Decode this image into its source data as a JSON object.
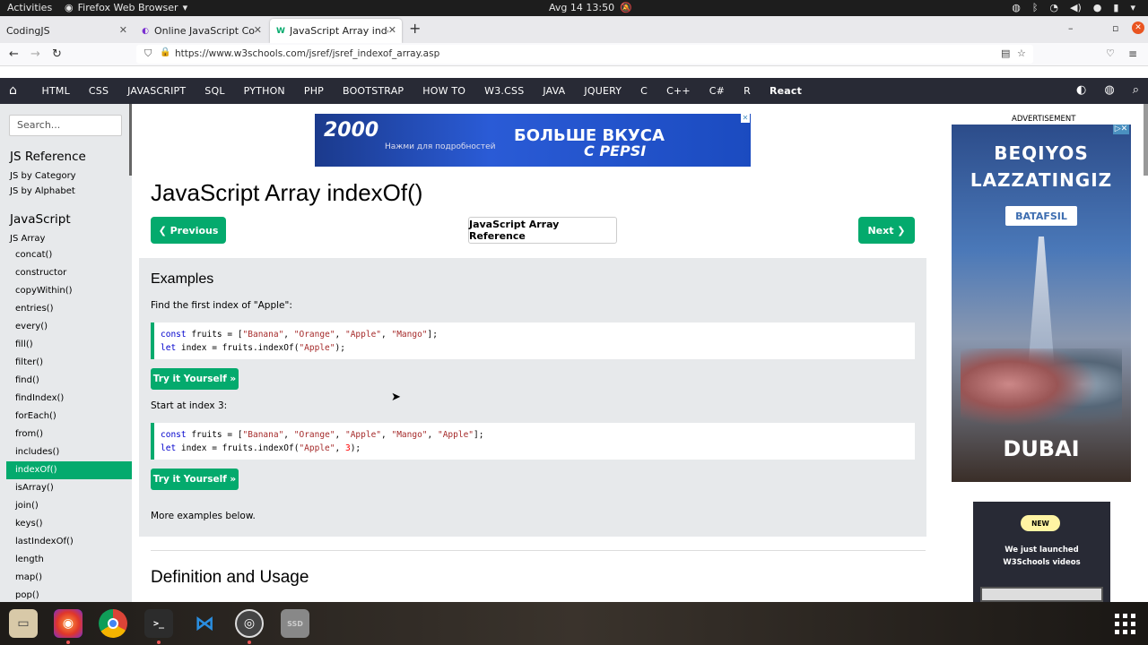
{
  "os": {
    "activities": "Activities",
    "app_name": "Firefox Web Browser",
    "clock": "Avg 14  13:50"
  },
  "tabs": [
    {
      "label": "CodingJS"
    },
    {
      "label": "Online JavaScript Compil"
    },
    {
      "label": "JavaScript Array indexOf"
    }
  ],
  "address_bar": {
    "url": "https://www.w3schools.com/jsref/jsref_indexof_array.asp"
  },
  "w3nav": {
    "items": [
      "HTML",
      "CSS",
      "JAVASCRIPT",
      "SQL",
      "PYTHON",
      "PHP",
      "BOOTSTRAP",
      "HOW TO",
      "W3.CSS",
      "JAVA",
      "JQUERY",
      "C",
      "C++",
      "C#",
      "R",
      "React"
    ]
  },
  "sidebar": {
    "search_placeholder": "Search...",
    "heading1": "JS Reference",
    "link1": "JS by Category",
    "link2": "JS by Alphabet",
    "heading2": "JavaScript",
    "section": "JS Array",
    "items": [
      "concat()",
      "constructor",
      "copyWithin()",
      "entries()",
      "every()",
      "fill()",
      "filter()",
      "find()",
      "findIndex()",
      "forEach()",
      "from()",
      "includes()",
      "indexOf()",
      "isArray()",
      "join()",
      "keys()",
      "lastIndexOf()",
      "length",
      "map()",
      "pop()"
    ],
    "active_index": 12
  },
  "ad_banner": {
    "num": "2000",
    "sub": "Нажми для подробностей",
    "title": "БОЛЬШЕ ВКУСА",
    "brand": "С PEPSI"
  },
  "main": {
    "title": "JavaScript Array indexOf()",
    "prev_label": "❮ Previous",
    "ref_label": "JavaScript Array Reference",
    "next_label": "Next ❯",
    "examples_heading": "Examples",
    "ex1_text": "Find the first index of \"Apple\":",
    "ex1_code": {
      "l1_kw": "const",
      "l1_a": " fruits = [",
      "l1_s1": "\"Banana\"",
      "l1_s2": "\"Orange\"",
      "l1_s3": "\"Apple\"",
      "l1_s4": "\"Mango\"",
      "l1_end": "];",
      "l2_kw": "let",
      "l2_a": " index = fruits.indexOf(",
      "l2_s": "\"Apple\"",
      "l2_end": ");"
    },
    "try_label": "Try it Yourself »",
    "ex2_text": "Start at index 3:",
    "ex2_code": {
      "l1_kw": "const",
      "l1_a": " fruits = [",
      "l1_s1": "\"Banana\"",
      "l1_s2": "\"Orange\"",
      "l1_s3": "\"Apple\"",
      "l1_s4": "\"Mango\"",
      "l1_s5": "\"Apple\"",
      "l1_end": "];",
      "l2_kw": "let",
      "l2_a": " index = fruits.indexOf(",
      "l2_s": "\"Apple\"",
      "l2_num": "3",
      "l2_end": ");"
    },
    "more_text": "More examples below.",
    "h2": "Definition and Usage"
  },
  "right": {
    "ad_label": "ADVERTISEMENT",
    "ad_l1": "BEQIYOS",
    "ad_l2": "LAZZATINGIZ",
    "ad_btn": "BATAFSIL",
    "ad_brand": "DUBAI",
    "promo_badge": "NEW",
    "promo_l1": "We just launched",
    "promo_l2": "W3Schools videos"
  },
  "colors": {
    "accent": "#04aa6d",
    "nav": "#282a35",
    "sidebar": "#e7e9eb"
  }
}
